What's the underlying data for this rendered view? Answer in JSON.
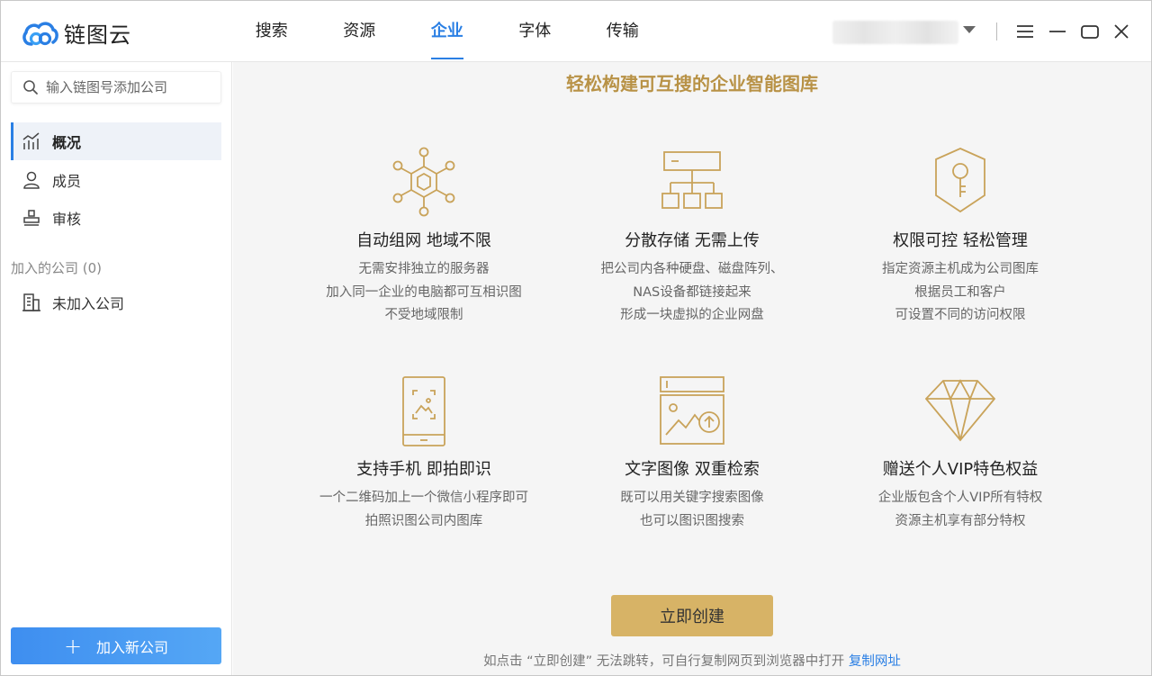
{
  "app": {
    "name": "链图云",
    "brand_color": "#2a7fe4",
    "gold_color": "#b89246"
  },
  "nav": {
    "items": [
      {
        "label": "搜索"
      },
      {
        "label": "资源"
      },
      {
        "label": "企业",
        "active": true
      },
      {
        "label": "字体"
      },
      {
        "label": "传输"
      }
    ]
  },
  "window_controls": [
    "menu-icon",
    "minimize-icon",
    "maximize-icon",
    "close-icon"
  ],
  "sidebar": {
    "search_placeholder": "输入链图号添加公司",
    "items": [
      {
        "label": "概况",
        "icon": "chart-icon",
        "active": true
      },
      {
        "label": "成员",
        "icon": "person-icon"
      },
      {
        "label": "审核",
        "icon": "stamp-icon"
      }
    ],
    "joined_label": "加入的公司 (0)",
    "joined_items": [
      {
        "label": "未加入公司",
        "icon": "building-icon"
      }
    ],
    "add_button": "加入新公司"
  },
  "main": {
    "headline": "轻松构建可互搜的企业智能图库",
    "features": [
      {
        "icon": "network-icon",
        "title": "自动组网 地域不限",
        "lines": [
          "无需安排独立的服务器",
          "加入同一企业的电脑都可互相识图",
          "不受地域限制"
        ]
      },
      {
        "icon": "storage-icon",
        "title": "分散存储 无需上传",
        "lines": [
          "把公司内各种硬盘、磁盘阵列、",
          "NAS设备都链接起来",
          "形成一块虚拟的企业网盘"
        ]
      },
      {
        "icon": "shield-key-icon",
        "title": "权限可控 轻松管理",
        "lines": [
          "指定资源主机成为公司图库",
          "根据员工和客户",
          "可设置不同的访问权限"
        ]
      },
      {
        "icon": "phone-scan-icon",
        "title": "支持手机 即拍即识",
        "lines": [
          "一个二维码加上一个微信小程序即可",
          "拍照识图公司内图库"
        ]
      },
      {
        "icon": "image-search-icon",
        "title": "文字图像 双重检索",
        "lines": [
          "既可以用关键字搜索图像",
          "也可以图识图搜索"
        ]
      },
      {
        "icon": "diamond-icon",
        "title": "赠送个人VIP特色权益",
        "lines": [
          "企业版包含个人VIP所有特权",
          "资源主机享有部分特权"
        ]
      }
    ],
    "create_button": "立即创建",
    "hint_text": "如点击 “立即创建” 无法跳转，可自行复制网页到浏览器中打开",
    "hint_link": "复制网址"
  }
}
